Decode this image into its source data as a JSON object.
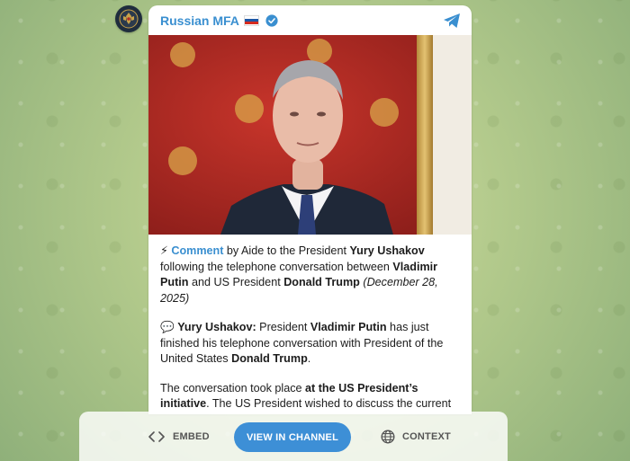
{
  "channel": {
    "name": "Russian MFA"
  },
  "post": {
    "p1": {
      "icon": "⚡",
      "link": "Comment",
      "t1": " by Aide to the President ",
      "b1": "Yury Ushakov",
      "t2": " following the telephone conversation between ",
      "b2": "Vladimir Putin",
      "t3": " and US President ",
      "b3": "Donald Trump",
      "date": "(December 28, 2025)"
    },
    "p2": {
      "icon": "💬",
      "b1": "Yury Ushakov:",
      "t1": " President ",
      "b2": "Vladimir Putin",
      "t2": " has just finished his telephone conversation with President of the United States ",
      "b3": "Donald Trump",
      "t3": "."
    },
    "p3": {
      "t1": "The conversation took place ",
      "b1": "at the US President’s initiative",
      "t2": ". The US President wished to discuss the current developments in the context of the Ukrainian conflict and his upcoming talks with the President of Ukraine"
    }
  },
  "actions": {
    "embed_label": "EMBED",
    "view_label": "VIEW IN CHANNEL",
    "context_label": "CONTEXT"
  },
  "colors": {
    "accent": "#3a8fd0",
    "button": "#3d8fd6",
    "photo_wall": "#b22a23"
  }
}
